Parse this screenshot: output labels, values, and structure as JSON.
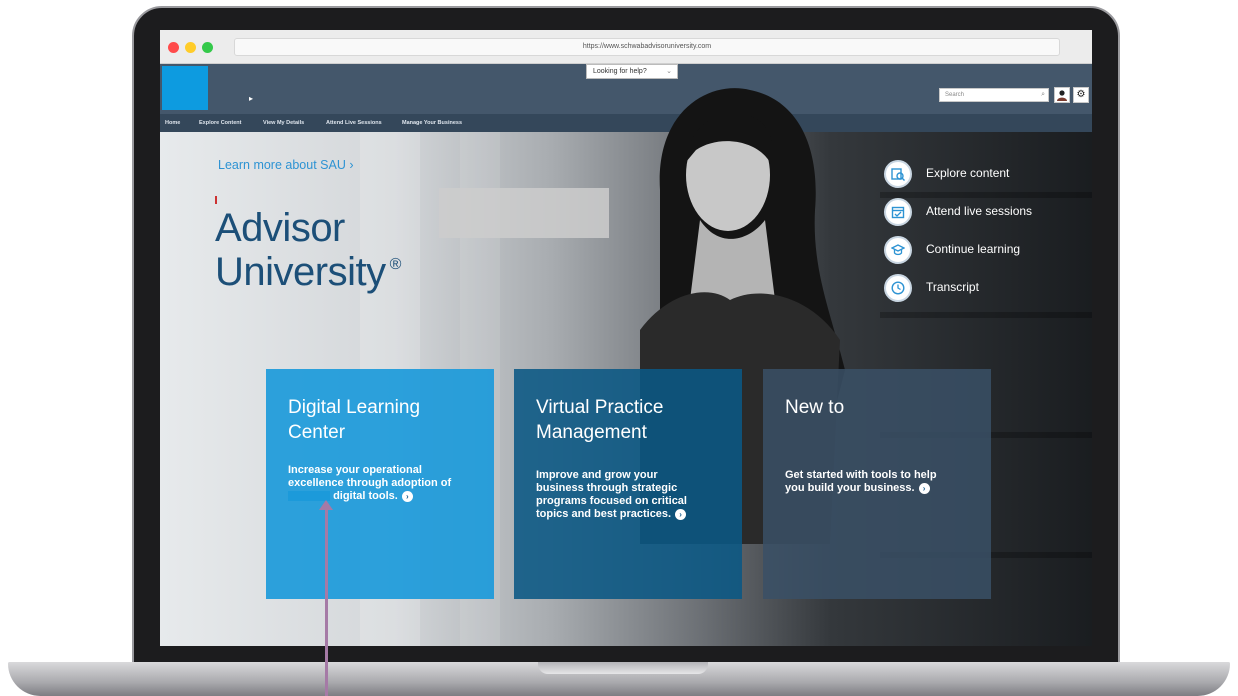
{
  "browser": {
    "url": "https://www.schwabadvisoruniversity.com"
  },
  "header": {
    "help_select": "Looking for help?",
    "search_placeholder": "Search",
    "arrow": "▸"
  },
  "nav": {
    "items": [
      {
        "label": "Home"
      },
      {
        "label": "Explore Content"
      },
      {
        "label": "View My Details"
      },
      {
        "label": "Attend Live Sessions"
      },
      {
        "label": "Manage Your Business"
      }
    ]
  },
  "hero": {
    "learn_more": "Learn more about SAU ›",
    "title_line1": "Advisor",
    "title_line2": "University",
    "registered": "®"
  },
  "quick_links": [
    {
      "label": "Explore content",
      "icon": "explore-content-icon"
    },
    {
      "label": "Attend live sessions",
      "icon": "calendar-icon"
    },
    {
      "label": "Continue learning",
      "icon": "graduation-cap-icon"
    },
    {
      "label": "Transcript",
      "icon": "clock-icon"
    }
  ],
  "cards": [
    {
      "title": "Digital Learning Center",
      "text_before": "Increase your operational excellence through adoption of",
      "text_after": "digital tools.",
      "color": "#1c9ada"
    },
    {
      "title": "Virtual Practice Management",
      "text": "Improve and grow your business through strategic programs focused on critical topics and best practices.",
      "color": "#0a5884"
    },
    {
      "title": "New to",
      "text": "Get started with tools to help you build your business.",
      "color": "#3a5066"
    }
  ],
  "colors": {
    "header_bg": "#44576b",
    "nav_bg": "#34475a",
    "logo_blue": "#0d9be0",
    "title_blue": "#1c4f78",
    "link_blue": "#2d93d3",
    "pointer": "#a57aa6"
  }
}
